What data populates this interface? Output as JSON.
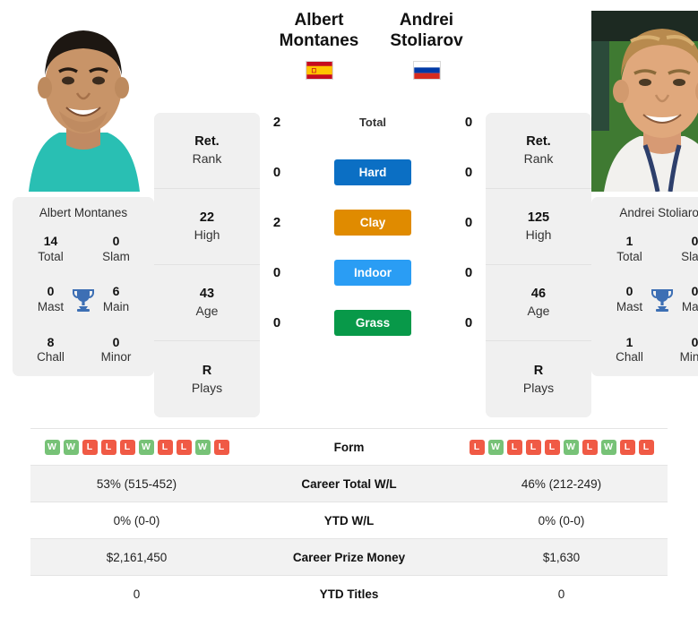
{
  "left_player": {
    "name_line1": "Albert",
    "name_line2": "Montanes",
    "full_name": "Albert Montanes",
    "flag": "spain-flag",
    "titles": {
      "total_value": "14",
      "total_label": "Total",
      "slam_value": "0",
      "slam_label": "Slam",
      "mast_value": "0",
      "mast_label": "Mast",
      "main_value": "6",
      "main_label": "Main",
      "chall_value": "8",
      "chall_label": "Chall",
      "minor_value": "0",
      "minor_label": "Minor",
      "trophy_icon": "trophy-icon"
    },
    "ranks": [
      {
        "value": "Ret.",
        "label": "Rank"
      },
      {
        "value": "22",
        "label": "High"
      },
      {
        "value": "43",
        "label": "Age"
      },
      {
        "value": "R",
        "label": "Plays"
      }
    ],
    "photo_alt": "Albert Montanes photo"
  },
  "right_player": {
    "name_line1": "Andrei",
    "name_line2": "Stoliarov",
    "full_name": "Andrei Stoliarov",
    "flag": "russia-flag",
    "titles": {
      "total_value": "1",
      "total_label": "Total",
      "slam_value": "0",
      "slam_label": "Slam",
      "mast_value": "0",
      "mast_label": "Mast",
      "main_value": "0",
      "main_label": "Main",
      "chall_value": "1",
      "chall_label": "Chall",
      "minor_value": "0",
      "minor_label": "Minor",
      "trophy_icon": "trophy-icon"
    },
    "ranks": [
      {
        "value": "Ret.",
        "label": "Rank"
      },
      {
        "value": "125",
        "label": "High"
      },
      {
        "value": "46",
        "label": "Age"
      },
      {
        "value": "R",
        "label": "Plays"
      }
    ],
    "photo_alt": "Andrei Stoliarov photo"
  },
  "surfaces": [
    {
      "label": "Total",
      "left": "2",
      "right": "0",
      "color": "transparent",
      "plain": true
    },
    {
      "label": "Hard",
      "left": "0",
      "right": "0",
      "color": "#0b6fc4",
      "plain": false
    },
    {
      "label": "Clay",
      "left": "2",
      "right": "0",
      "color": "#e08b00",
      "plain": false
    },
    {
      "label": "Indoor",
      "left": "0",
      "right": "0",
      "color": "#2a9df4",
      "plain": false
    },
    {
      "label": "Grass",
      "left": "0",
      "right": "0",
      "color": "#089949",
      "plain": false
    }
  ],
  "table": {
    "form_label": "Form",
    "left_form": [
      "W",
      "W",
      "L",
      "L",
      "L",
      "W",
      "L",
      "L",
      "W",
      "L"
    ],
    "right_form": [
      "L",
      "W",
      "L",
      "L",
      "L",
      "W",
      "L",
      "W",
      "L",
      "L"
    ],
    "rows": [
      {
        "left": "53% (515-452)",
        "label": "Career Total W/L",
        "right": "46% (212-249)",
        "shaded": true
      },
      {
        "left": "0% (0-0)",
        "label": "YTD W/L",
        "right": "0% (0-0)",
        "shaded": false
      },
      {
        "left": "$2,161,450",
        "label": "Career Prize Money",
        "right": "$1,630",
        "shaded": true
      },
      {
        "left": "0",
        "label": "YTD Titles",
        "right": "0",
        "shaded": false
      }
    ]
  },
  "colors": {
    "card_bg": "#f0f0f0",
    "shaded_row": "#f2f2f2",
    "win_badge": "#77c277",
    "loss_badge": "#f05a45",
    "trophy": "#3d6fb4"
  }
}
